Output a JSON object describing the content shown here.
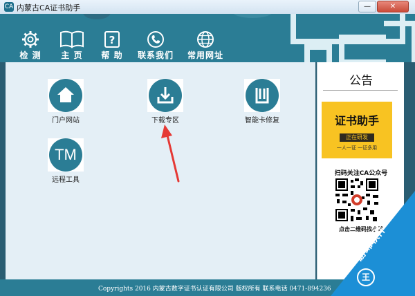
{
  "window": {
    "title": "内蒙古CA证书助手",
    "app_icon": "CA",
    "min_symbol": "—",
    "close_symbol": "✕"
  },
  "toolbar": {
    "items": [
      {
        "label": "检 测",
        "icon": "gear-icon"
      },
      {
        "label": "主 页",
        "icon": "book-icon"
      },
      {
        "label": "帮 助",
        "icon": "help-icon"
      },
      {
        "label": "联系我们",
        "icon": "phone-icon"
      },
      {
        "label": "常用网址",
        "icon": "globe-icon"
      }
    ]
  },
  "tiles": [
    {
      "label": "门户网站",
      "icon": "home-icon"
    },
    {
      "label": "下载专区",
      "icon": "download-icon"
    },
    {
      "label": "智能卡修复",
      "icon": "card-repair-icon"
    },
    {
      "label": "远程工具",
      "icon": "tm-icon",
      "glyph": "TM"
    }
  ],
  "sidebar": {
    "title": "公告",
    "promo": {
      "title": "证书助手",
      "sub": "正在研发",
      "tagline": "一人一证 一证多用"
    },
    "scan_text": "扫码关注CA公众号",
    "qr_caption": "点击二维码找小呆"
  },
  "footer": {
    "text": "Copyrights 2016 内蒙古数字证书认证有限公司 版权所有   联系电话  0471-894236"
  },
  "watermark": {
    "text": "游绵软件",
    "logo": "王"
  },
  "colors": {
    "brand_teal": "#2b7d95",
    "panel_bg": "#e4eff6",
    "annotation_arrow": "#e53935",
    "promo_yellow": "#f8c322",
    "watermark_blue": "#1c8fd6"
  }
}
